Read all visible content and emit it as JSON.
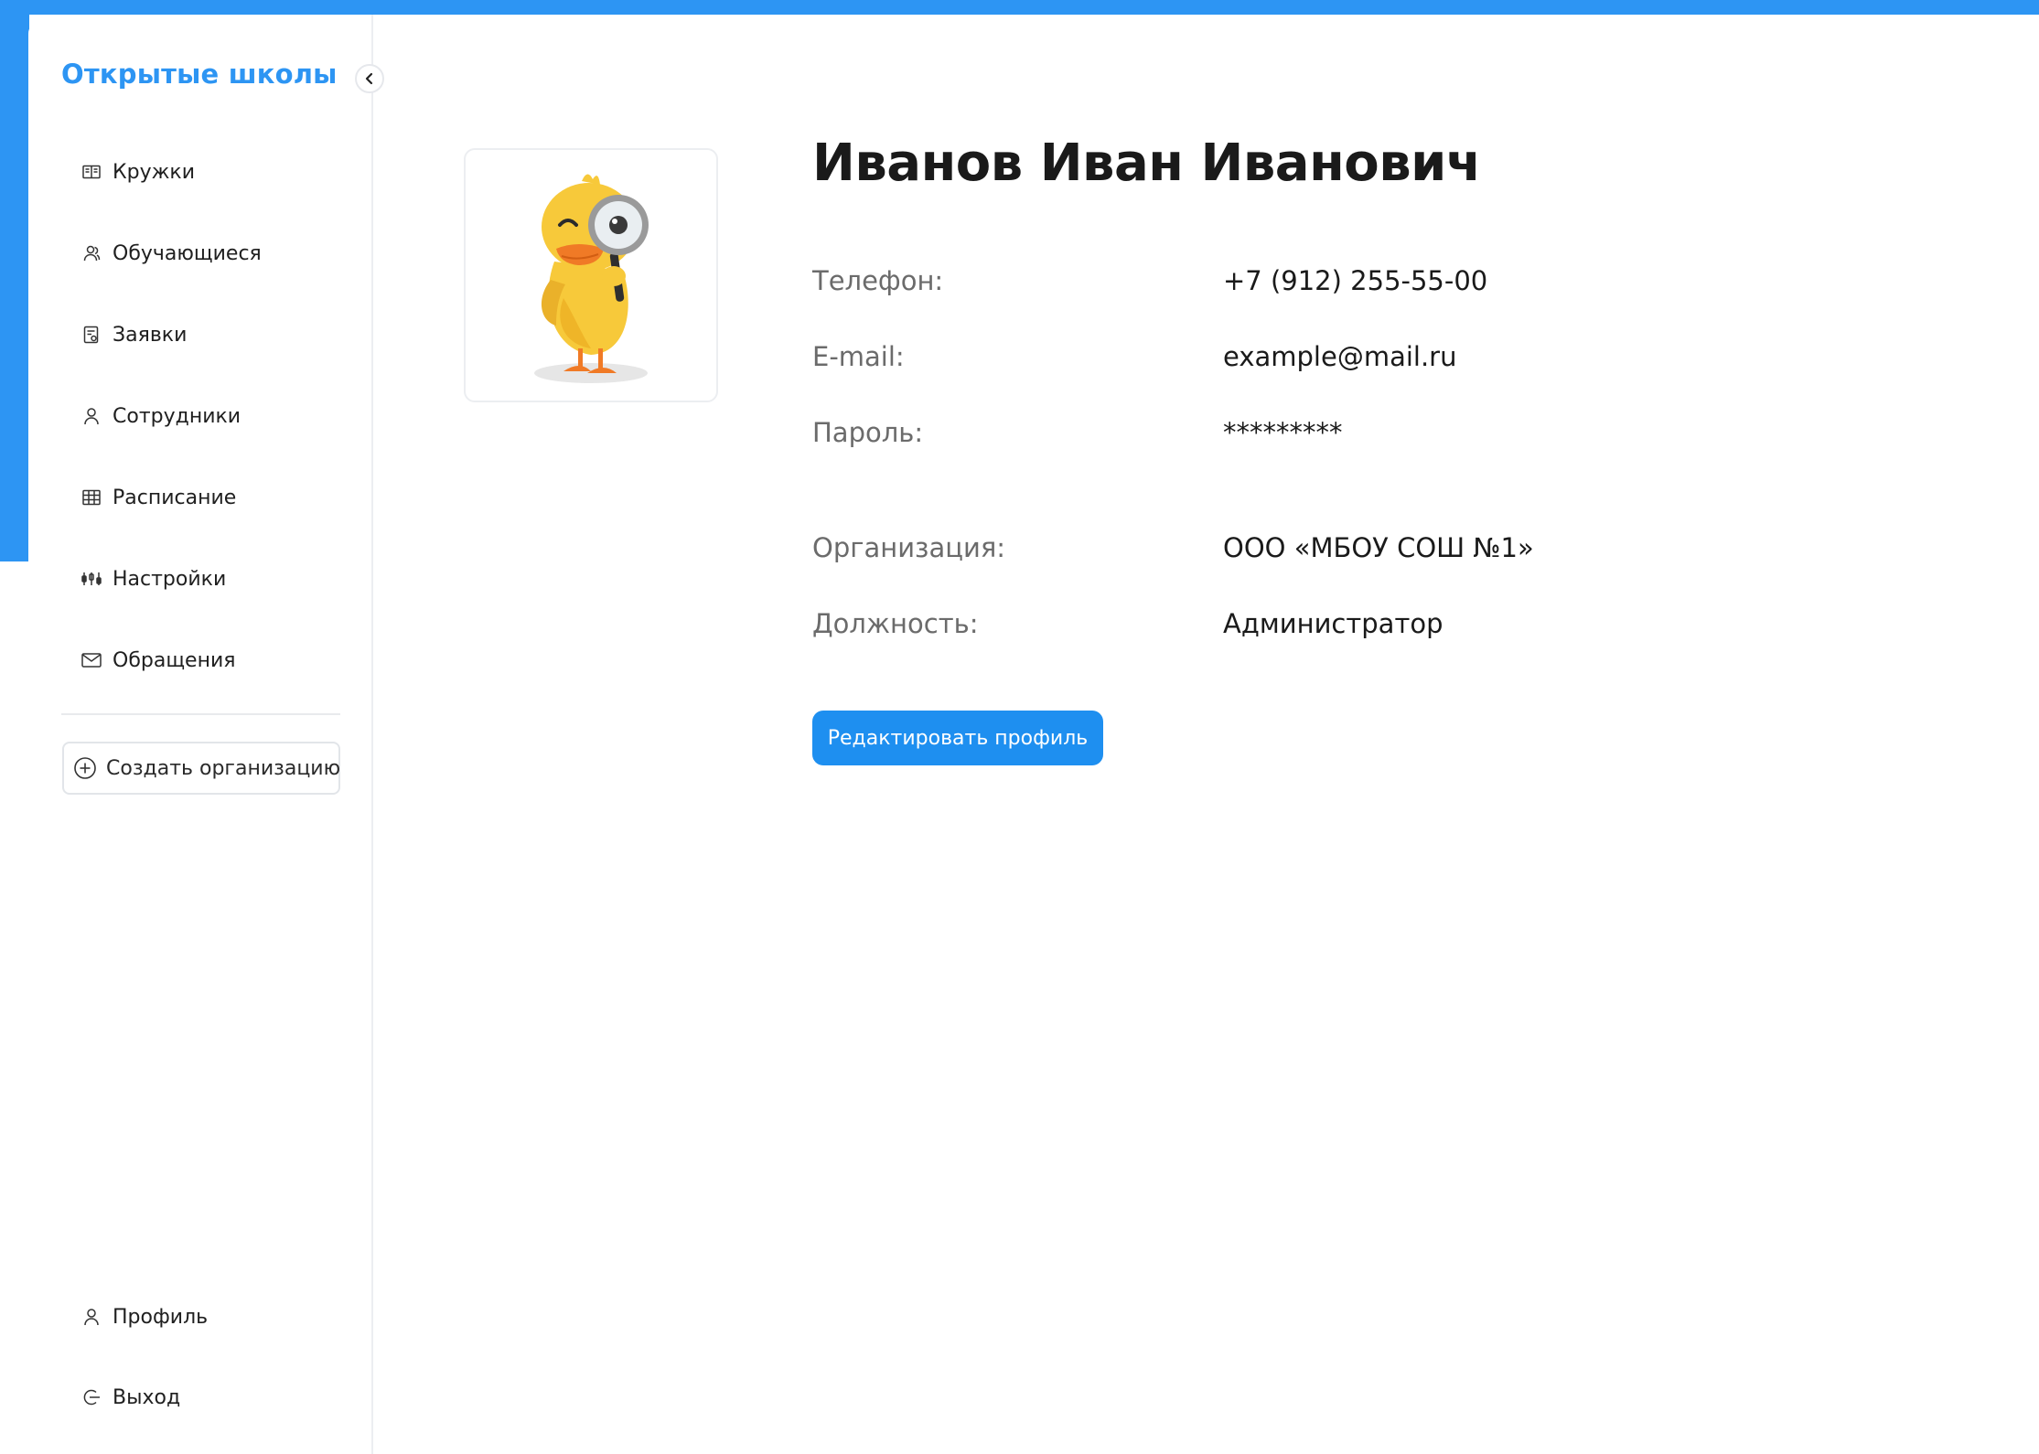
{
  "brand": {
    "title": "Открытые школы",
    "accent": "#2d95f3"
  },
  "sidebar": {
    "items": [
      {
        "label": "Кружки",
        "icon": "book-open-icon"
      },
      {
        "label": "Обучающиеся",
        "icon": "students-icon"
      },
      {
        "label": "Заявки",
        "icon": "document-icon"
      },
      {
        "label": "Сотрудники",
        "icon": "user-icon"
      },
      {
        "label": "Расписание",
        "icon": "table-grid-icon"
      },
      {
        "label": "Настройки",
        "icon": "sliders-icon"
      },
      {
        "label": "Обращения",
        "icon": "mail-icon"
      }
    ],
    "create_org_label": "Создать организацию",
    "bottom": [
      {
        "label": "Профиль",
        "icon": "user-icon"
      },
      {
        "label": "Выход",
        "icon": "logout-icon"
      }
    ]
  },
  "profile": {
    "name": "Иванов Иван Иванович",
    "fields": [
      {
        "label": "Телефон:",
        "value": "+7 (912) 255-55-00"
      },
      {
        "label": "E-mail:",
        "value": "example@mail.ru"
      },
      {
        "label": "Пароль:",
        "value": "*********"
      },
      {
        "label": "Организация:",
        "value": "ООО «МБОУ СОШ №1»"
      },
      {
        "label": "Должность:",
        "value": "Администратор"
      }
    ],
    "edit_button_label": "Редактировать профиль",
    "avatar_icon": "duck-magnifier-illustration"
  }
}
